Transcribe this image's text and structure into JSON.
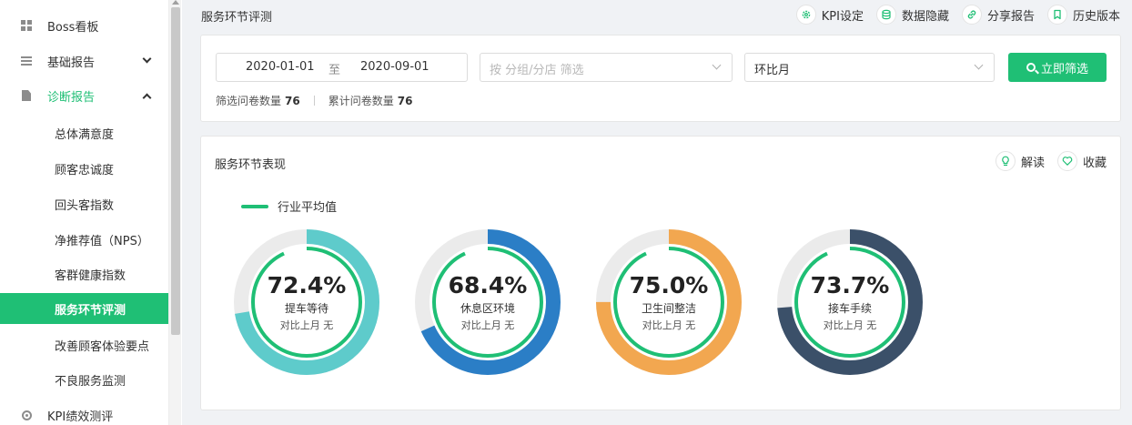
{
  "sidebar": {
    "items": [
      {
        "label": "Boss看板",
        "icon": "grid-icon"
      },
      {
        "label": "基础报告",
        "icon": "list-icon",
        "chevron": "down"
      },
      {
        "label": "诊断报告",
        "icon": "doc-icon",
        "chevron": "up"
      }
    ],
    "sub_items": [
      {
        "label": "总体满意度"
      },
      {
        "label": "顾客忠诚度"
      },
      {
        "label": "回头客指数"
      },
      {
        "label": "净推荐值（NPS）"
      },
      {
        "label": "客群健康指数"
      },
      {
        "label": "服务环节评测",
        "active": true
      },
      {
        "label": "改善顾客体验要点"
      },
      {
        "label": "不良服务监测"
      }
    ],
    "bottom_item": {
      "label": "KPI绩效测评",
      "icon": "target-icon"
    }
  },
  "header": {
    "title": "服务环节评测",
    "actions": [
      {
        "label": "KPI设定",
        "icon": "gear-icon"
      },
      {
        "label": "数据隐藏",
        "icon": "database-icon"
      },
      {
        "label": "分享报告",
        "icon": "link-icon"
      },
      {
        "label": "历史版本",
        "icon": "bookmark-icon"
      }
    ]
  },
  "filter": {
    "start_date": "2020-01-01",
    "separator": "至",
    "end_date": "2020-09-01",
    "group_placeholder": "按 分组/分店 筛选",
    "compare_value": "环比月",
    "search_label": "立即筛选",
    "filtered_label": "筛选问卷数量",
    "filtered_count": "76",
    "total_label": "累计问卷数量",
    "total_count": "76"
  },
  "performance": {
    "title": "服务环节表现",
    "interpret_label": "解读",
    "collect_label": "收藏",
    "legend_label": "行业平均值",
    "gauges": [
      {
        "percent_text": "72.4%",
        "percent": 72.4,
        "name": "提车等待",
        "compare": "对比上月 无",
        "color": "#5ecbcb",
        "industry_avg": 0.93
      },
      {
        "percent_text": "68.4%",
        "percent": 68.4,
        "name": "休息区环境",
        "compare": "对比上月 无",
        "color": "#2b7ec6",
        "industry_avg": 0.93
      },
      {
        "percent_text": "75.0%",
        "percent": 75.0,
        "name": "卫生间整洁",
        "compare": "对比上月 无",
        "color": "#f2a750",
        "industry_avg": 0.93
      },
      {
        "percent_text": "73.7%",
        "percent": 73.7,
        "name": "接车手续",
        "compare": "对比上月 无",
        "color": "#3b5069",
        "industry_avg": 0.93
      }
    ],
    "accent_color": "#1fbf75",
    "track_color": "#ebebeb"
  }
}
